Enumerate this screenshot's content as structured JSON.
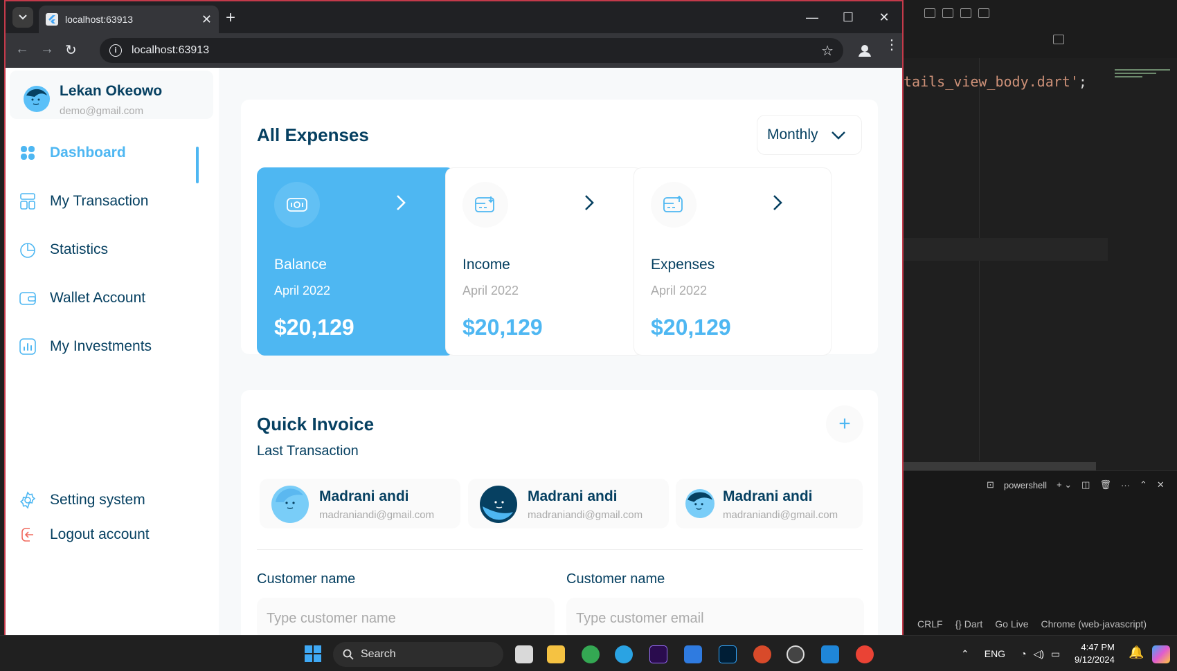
{
  "browser": {
    "tab_title": "localhost:63913",
    "url": "localhost:63913"
  },
  "sidebar": {
    "user": {
      "name": "Lekan Okeowo",
      "email": "demo@gmail.com"
    },
    "items": [
      {
        "label": "Dashboard",
        "icon": "grid-icon"
      },
      {
        "label": "My Transaction",
        "icon": "transaction-icon"
      },
      {
        "label": "Statistics",
        "icon": "pie-chart-icon"
      },
      {
        "label": "Wallet Account",
        "icon": "wallet-icon"
      },
      {
        "label": "My Investments",
        "icon": "bar-chart-icon"
      }
    ],
    "bottom": [
      {
        "label": "Setting system",
        "icon": "gear-icon"
      },
      {
        "label": "Logout account",
        "icon": "logout-icon"
      }
    ]
  },
  "expenses": {
    "title": "All Expenses",
    "period": "Monthly",
    "cards": [
      {
        "title": "Balance",
        "date": "April 2022",
        "amount": "$20,129"
      },
      {
        "title": "Income",
        "date": "April 2022",
        "amount": "$20,129"
      },
      {
        "title": "Expenses",
        "date": "April 2022",
        "amount": "$20,129"
      }
    ]
  },
  "invoice": {
    "title": "Quick Invoice",
    "subtitle": "Last Transaction",
    "people": [
      {
        "name": "Madrani andi",
        "email": "madraniandi@gmail.com"
      },
      {
        "name": "Madrani andi",
        "email": "madraniandi@gmail.com"
      },
      {
        "name": "Madrani andi",
        "email": "madraniandi@gmail.com"
      }
    ],
    "fields": [
      {
        "label": "Customer name",
        "placeholder": "Type customer name"
      },
      {
        "label": "Customer name",
        "placeholder": "Type customer email"
      }
    ]
  },
  "vscode": {
    "code_line": "tails_view_body.dart'",
    "terminal_label": "powershell",
    "status": [
      "CRLF",
      "{} Dart",
      "Go Live",
      "Chrome (web-javascript)"
    ]
  },
  "taskbar": {
    "search_label": "Search",
    "lang": "ENG",
    "time": "4:47 PM",
    "date": "9/12/2024"
  },
  "colors": {
    "accent": "#4eb7f2",
    "navy": "#064061",
    "muted": "#aaaaaa",
    "page_bg": "#f7f9fa"
  }
}
